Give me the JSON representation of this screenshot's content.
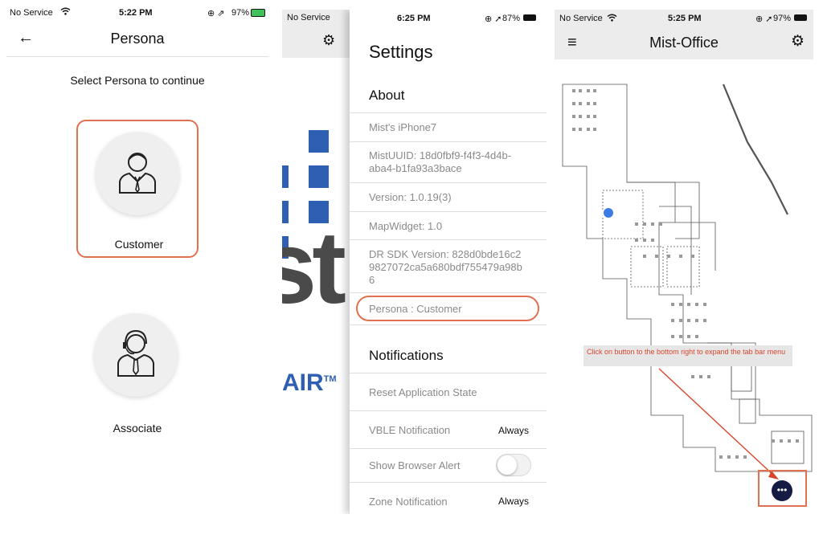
{
  "panel1": {
    "status": {
      "carrier": "No Service",
      "time": "5:22 PM",
      "battery": "97%"
    },
    "title": "Persona",
    "prompt": "Select Persona to continue",
    "personas": [
      {
        "label": "Customer",
        "selected": true
      },
      {
        "label": "Associate",
        "selected": false
      }
    ]
  },
  "panel2": {
    "status": {
      "carrier": "No Service",
      "time": "6:25 PM",
      "battery": "87%"
    },
    "logo_text": "st",
    "logo_sub": "AIR",
    "logo_tm": "TM",
    "title": "Settings",
    "about_header": "About",
    "about_rows": [
      "Mist's iPhone7",
      "MistUUID: 18d0fbf9-f4f3-4d4b-aba4-b1fa93a3bace",
      "Version: 1.0.19(3)",
      "MapWidget: 1.0",
      "DR SDK Version: 828d0bde16c29827072ca5a680bdf755479a98b6",
      "Persona : Customer"
    ],
    "notifications_header": "Notifications",
    "notif_rows": [
      {
        "label": "Reset Application State",
        "value": ""
      },
      {
        "label": "VBLE Notification",
        "value": "Always"
      },
      {
        "label": "Show Browser Alert",
        "value": ""
      },
      {
        "label": "Zone Notification",
        "value": "Always"
      }
    ],
    "browser_alert_on": false
  },
  "panel3": {
    "status": {
      "carrier": "No Service",
      "time": "5:25 PM",
      "battery": "97%"
    },
    "title": "Mist-Office",
    "callout": "Click on button to the bottom right to expand the tab bar menu",
    "fab_label": "•••"
  },
  "colors": {
    "accent": "#e0704f",
    "logo_blue": "#2f5fb3",
    "fab": "#151b42",
    "location_dot": "#3d7be8"
  }
}
